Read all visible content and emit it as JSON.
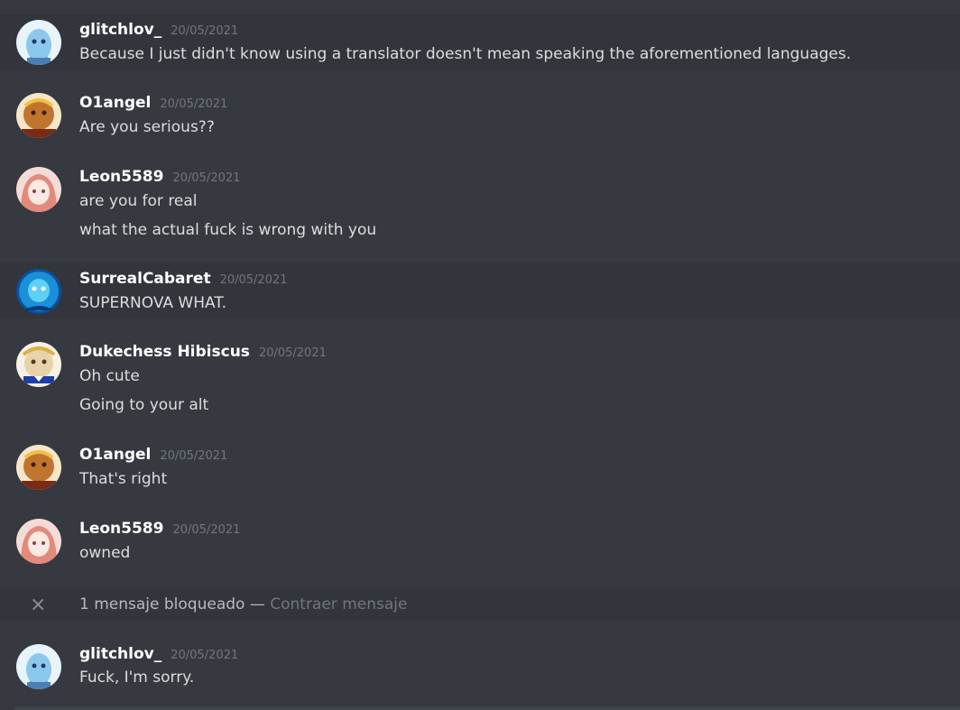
{
  "messages": [
    {
      "username": "glitchlov_",
      "timestamp": "20/05/2021",
      "lines": [
        "Because I just didn't know using a translator doesn't mean speaking the aforementioned languages."
      ],
      "avatar": "ghost-avatar-icon"
    },
    {
      "username": "O1angel",
      "timestamp": "20/05/2021",
      "lines": [
        "Are you serious??"
      ],
      "avatar": "cookie-avatar-icon"
    },
    {
      "username": "Leon5589",
      "timestamp": "20/05/2021",
      "lines": [
        "are you for real",
        "what the actual fuck is wrong with you"
      ],
      "avatar": "anime-girl-avatar-icon"
    },
    {
      "username": "SurrealCabaret",
      "timestamp": "20/05/2021",
      "lines": [
        "SUPERNOVA WHAT."
      ],
      "avatar": "blue-character-avatar-icon"
    },
    {
      "username": "Dukechess Hibiscus",
      "timestamp": "20/05/2021",
      "lines": [
        "Oh cute",
        "Going to your alt"
      ],
      "avatar": "sailor-cookie-avatar-icon"
    },
    {
      "username": "O1angel",
      "timestamp": "20/05/2021",
      "lines": [
        "That's right"
      ],
      "avatar": "cookie-avatar-icon"
    },
    {
      "username": "Leon5589",
      "timestamp": "20/05/2021",
      "lines": [
        "owned"
      ],
      "avatar": "anime-girl-avatar-icon"
    },
    {
      "username": "glitchlov_",
      "timestamp": "20/05/2021",
      "lines": [
        "Fuck, I'm sorry."
      ],
      "avatar": "ghost-avatar-icon"
    }
  ],
  "blocked": {
    "text": "1 mensaje bloqueado — ",
    "link": "Contraer mensaje",
    "icon": "close-icon"
  },
  "colors": {
    "background": "#36393f",
    "hover_background": "#32353b",
    "username": "#ffffff",
    "text": "#dcddde",
    "timestamp": "#72767d"
  }
}
